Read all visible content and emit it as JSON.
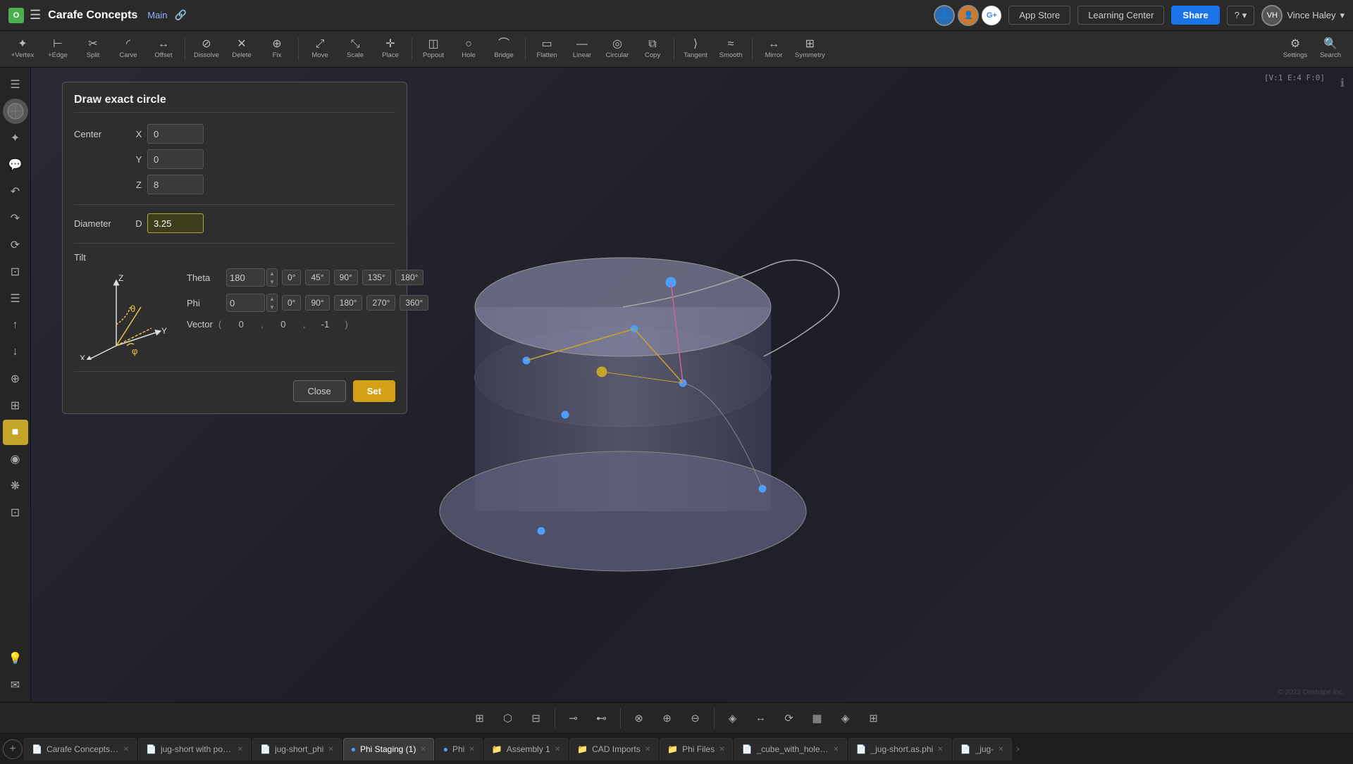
{
  "app": {
    "name": "onshape",
    "logo_char": "O"
  },
  "header": {
    "project_name": "Carafe Concepts",
    "branch": "Main",
    "app_store_label": "App Store",
    "learning_center_label": "Learning Center",
    "share_label": "Share",
    "help_label": "?",
    "user_name": "Vince Haley",
    "coord_display": "V:1 E:4 F:0"
  },
  "toolbar": {
    "tools": [
      {
        "icon": "✦",
        "label": "+Vertex"
      },
      {
        "icon": "⊢",
        "label": "+Edge"
      },
      {
        "icon": "✂",
        "label": "Split"
      },
      {
        "icon": "◜",
        "label": "Carve"
      },
      {
        "icon": "↔",
        "label": "Offset"
      },
      {
        "icon": "⊘",
        "label": "Dissolve"
      },
      {
        "icon": "✕",
        "label": "Delete"
      },
      {
        "icon": "⊕",
        "label": "Fix"
      },
      {
        "icon": "⤢",
        "label": "Move"
      },
      {
        "icon": "⤡",
        "label": "Scale"
      },
      {
        "icon": "✛",
        "label": "Place"
      },
      {
        "icon": "◫",
        "label": "Popout"
      },
      {
        "icon": "○",
        "label": "Hole"
      },
      {
        "icon": "⌒",
        "label": "Bridge"
      },
      {
        "icon": "▭",
        "label": "Flatten"
      },
      {
        "icon": "—",
        "label": "Linear"
      },
      {
        "icon": "◎",
        "label": "Circular"
      },
      {
        "icon": "⧉",
        "label": "Copy"
      },
      {
        "icon": "⟩",
        "label": "Tangent"
      },
      {
        "icon": "≈",
        "label": "Smooth"
      },
      {
        "icon": "↔",
        "label": "Mirror"
      },
      {
        "icon": "⊞",
        "label": "Symmetry"
      },
      {
        "icon": "⚙",
        "label": "Settings"
      },
      {
        "icon": "🔍",
        "label": "Search"
      }
    ]
  },
  "dialog": {
    "title": "Draw exact circle",
    "center_label": "Center",
    "x_label": "X",
    "y_label": "Y",
    "z_label": "Z",
    "x_value": "0",
    "y_value": "0",
    "z_value": "8",
    "diameter_label": "Diameter",
    "d_label": "D",
    "diameter_value": "3.25",
    "tilt_label": "Tilt",
    "theta_label": "Theta",
    "theta_value": "180",
    "theta_angles": [
      "0°",
      "45°",
      "90°",
      "135°",
      "180°"
    ],
    "phi_label": "Phi",
    "phi_value": "0",
    "phi_angles": [
      "0°",
      "90°",
      "180°",
      "270°",
      "360°"
    ],
    "vector_label": "Vector",
    "vector_paren_open": "(",
    "vector_x": "0",
    "vector_comma1": ",",
    "vector_y": "0",
    "vector_comma2": ",",
    "vector_z": "-1",
    "vector_paren_close": ")",
    "close_label": "Close",
    "set_label": "Set"
  },
  "sidebar": {
    "tools": [
      {
        "icon": "☰",
        "label": "menu"
      },
      {
        "icon": "✦",
        "label": "add"
      },
      {
        "icon": "💬",
        "label": "comments"
      },
      {
        "icon": "↶",
        "label": "undo"
      },
      {
        "icon": "↷",
        "label": "redo"
      },
      {
        "icon": "⟳",
        "label": "refresh"
      },
      {
        "icon": "⊡",
        "label": "view-box"
      },
      {
        "icon": "☰",
        "label": "list"
      },
      {
        "icon": "↑",
        "label": "upload"
      },
      {
        "icon": "↓",
        "label": "download"
      },
      {
        "icon": "⊕",
        "label": "add-ref"
      },
      {
        "icon": "⊞",
        "label": "grid"
      },
      {
        "icon": "■",
        "label": "solid"
      },
      {
        "icon": "◉",
        "label": "color"
      },
      {
        "icon": "❋",
        "label": "star"
      },
      {
        "icon": "⊡",
        "label": "cube"
      },
      {
        "icon": "💡",
        "label": "light"
      },
      {
        "icon": "✉",
        "label": "mail"
      }
    ]
  },
  "bottom_toolbar": {
    "tools": [
      {
        "icon": "⊞",
        "label": "grid-view"
      },
      {
        "icon": "⬡",
        "label": "hex-view"
      },
      {
        "icon": "⊟",
        "label": "compact"
      },
      {
        "icon": "⊸",
        "label": "split-h"
      },
      {
        "icon": "⊷",
        "label": "split-v"
      },
      {
        "icon": "⊗",
        "label": "zoom-fit"
      },
      {
        "icon": "⊕",
        "label": "zoom-in"
      },
      {
        "icon": "⊖",
        "label": "zoom-out"
      },
      {
        "icon": "◈",
        "label": "center"
      },
      {
        "icon": "↔",
        "label": "mirror"
      },
      {
        "icon": "⟳",
        "label": "rotate"
      },
      {
        "icon": "▦",
        "label": "wireframe"
      },
      {
        "icon": "◈",
        "label": "display"
      },
      {
        "icon": "⊞",
        "label": "viewport"
      }
    ]
  },
  "tabs": [
    {
      "icon": "📄",
      "label": "Carafe Concepts_phi",
      "active": false,
      "color": "#888"
    },
    {
      "icon": "📄",
      "label": "jug-short with pour...",
      "active": false,
      "color": "#888"
    },
    {
      "icon": "📄",
      "label": "jug-short_phi",
      "active": false,
      "color": "#888"
    },
    {
      "icon": "🔵",
      "label": "Phi Staging (1)",
      "active": true,
      "color": "#4a9eff"
    },
    {
      "icon": "🔵",
      "label": "Phi",
      "active": false,
      "color": "#4a9eff"
    },
    {
      "icon": "📁",
      "label": "Assembly 1",
      "active": false,
      "color": "#888"
    },
    {
      "icon": "📁",
      "label": "CAD Imports",
      "active": false,
      "color": "#888"
    },
    {
      "icon": "📁",
      "label": "Phi Files",
      "active": false,
      "color": "#888"
    },
    {
      "icon": "📄",
      "label": "_cube_with_hole.as.phi",
      "active": false,
      "color": "#888"
    },
    {
      "icon": "📄",
      "label": "_jug-short.as.phi",
      "active": false,
      "color": "#888"
    },
    {
      "icon": "📄",
      "label": "_jug-",
      "active": false,
      "color": "#888"
    }
  ]
}
